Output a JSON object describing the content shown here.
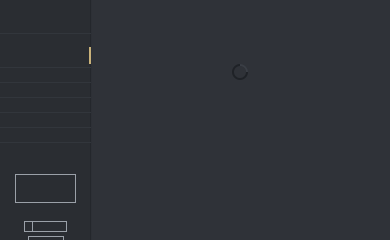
{
  "app": {
    "state": "loading"
  },
  "side_panel": {
    "row_count": 7
  },
  "icons": {
    "spinner": "loading-spinner-icon"
  },
  "colors": {
    "background": "#2d3036",
    "panel": "#2a2d32",
    "accent_handle": "#c9b27a",
    "outline": "#9aa0a8"
  }
}
